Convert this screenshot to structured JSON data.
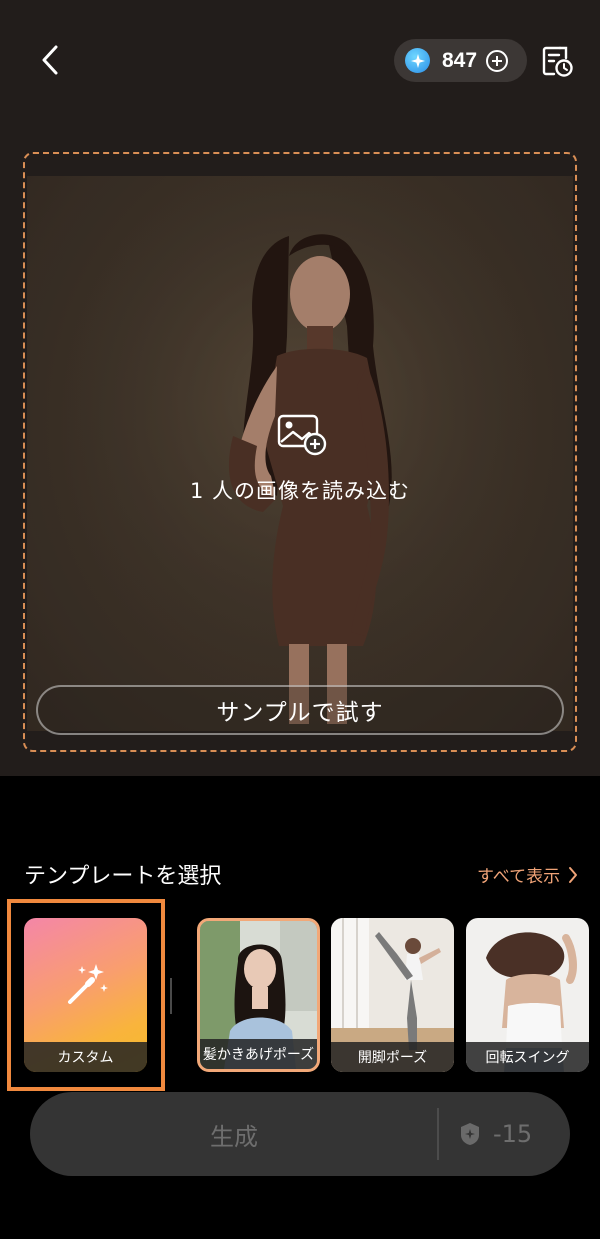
{
  "header": {
    "credits": "847",
    "colors": {
      "gem": "#2a8ee8",
      "accent": "#f0a377",
      "frame": "#d98e55"
    }
  },
  "upload": {
    "prompt": "1 人の画像を読み込む",
    "sample_button": "サンプルで試す"
  },
  "templates": {
    "title": "テンプレートを選択",
    "see_all": "すべて表示",
    "items": [
      {
        "label": "カスタム",
        "icon": "magic-wand-icon"
      },
      {
        "label": "髪かきあげポーズ"
      },
      {
        "label": "開脚ポーズ"
      },
      {
        "label": "回転スイング"
      }
    ]
  },
  "generate": {
    "label": "生成",
    "cost": "-15"
  }
}
